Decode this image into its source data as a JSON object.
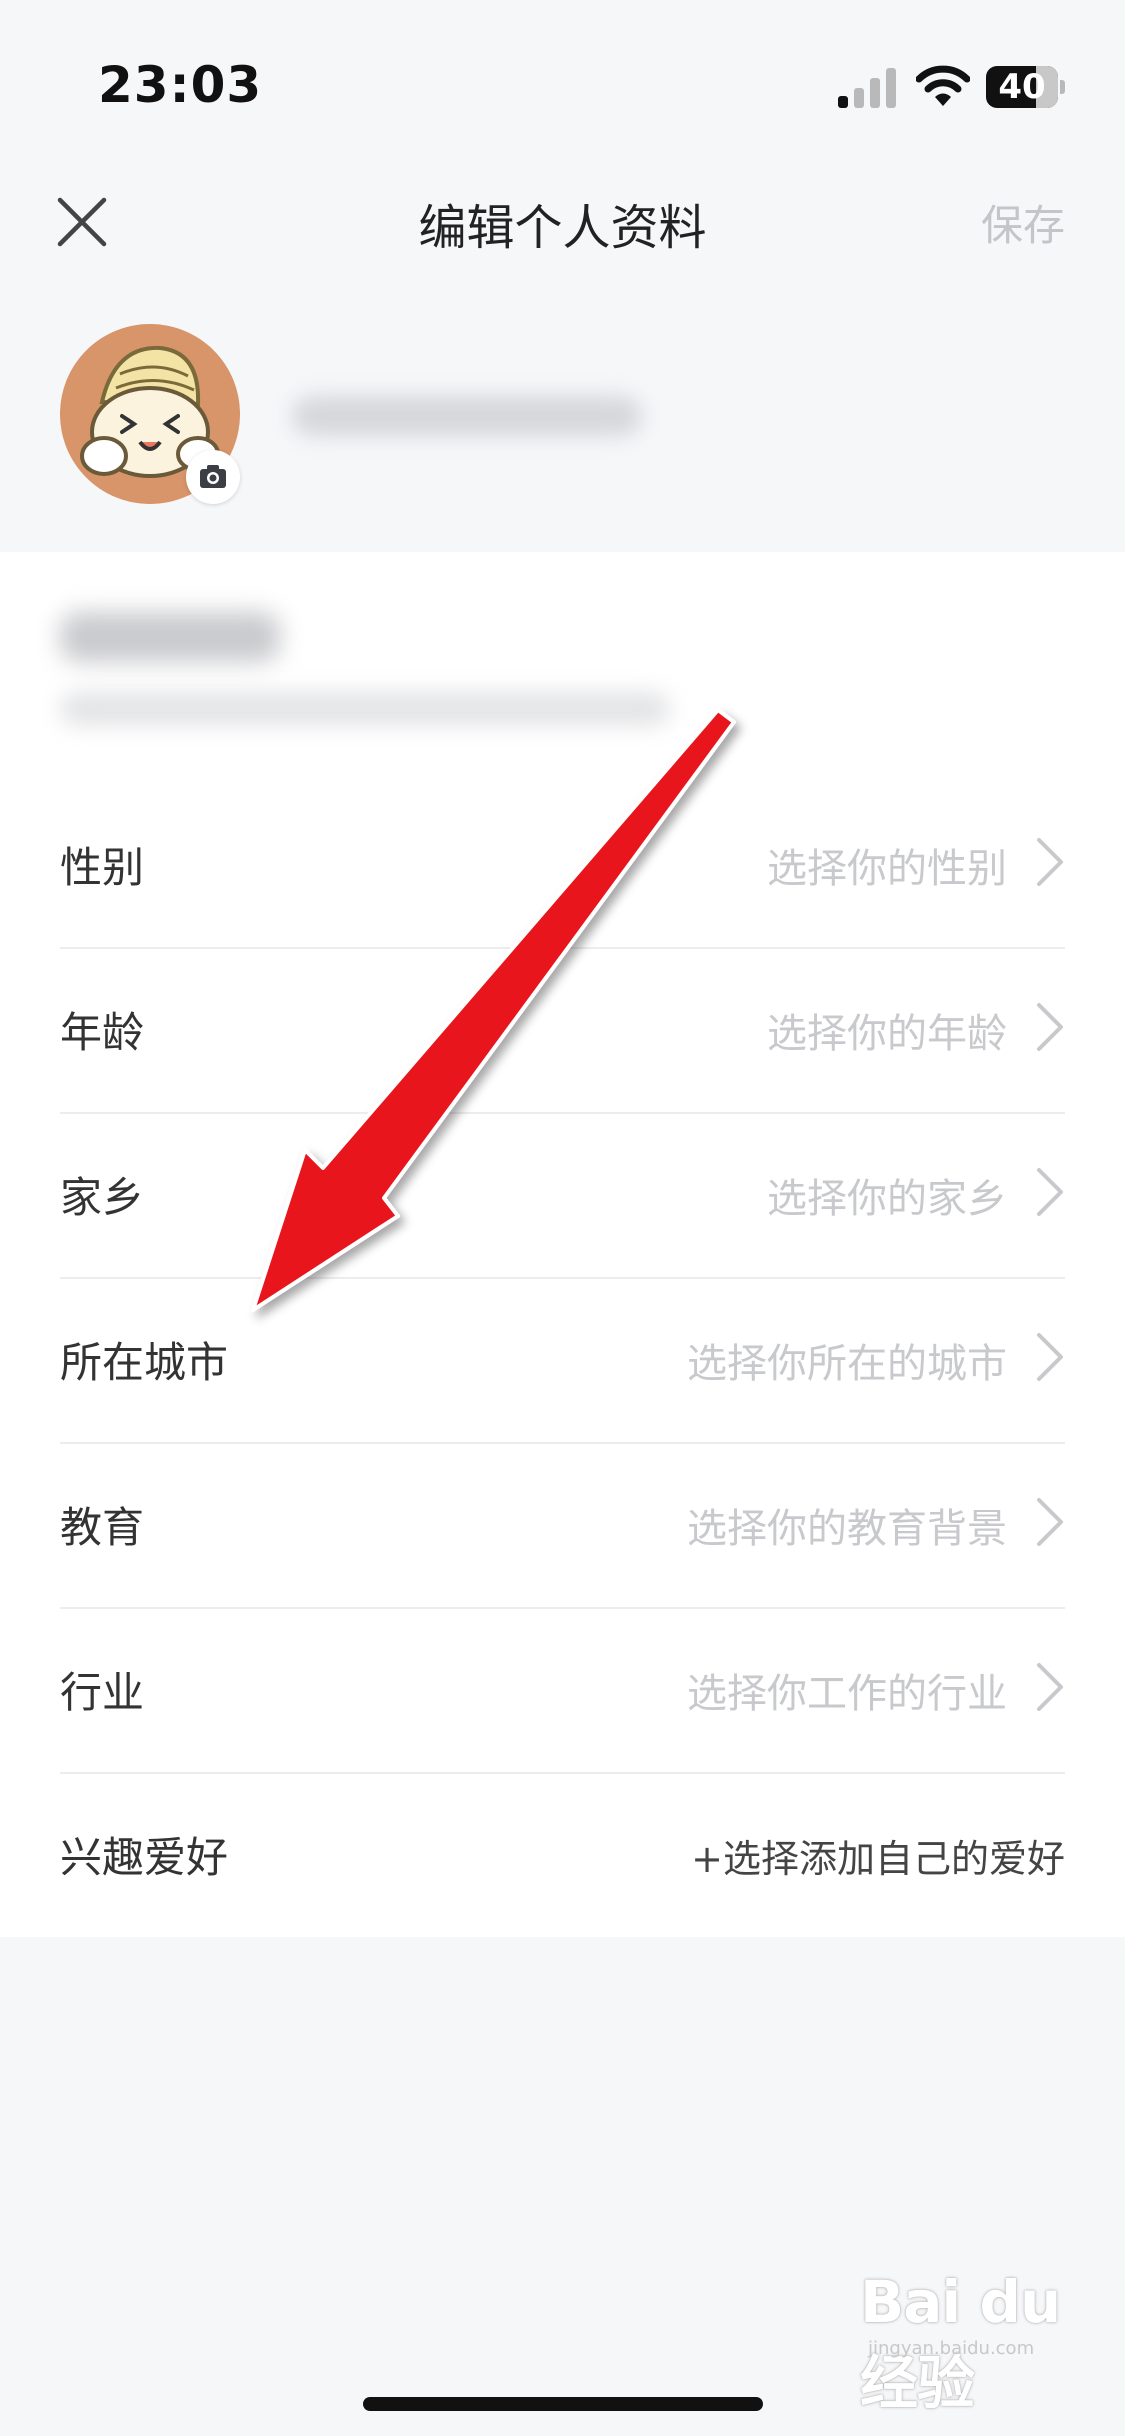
{
  "status_bar": {
    "time": "23:03",
    "battery": "40"
  },
  "header": {
    "title": "编辑个人资料",
    "save_label": "保存"
  },
  "fields": [
    {
      "label": "性别",
      "value": "选择你的性别"
    },
    {
      "label": "年龄",
      "value": "选择你的年龄"
    },
    {
      "label": "家乡",
      "value": "选择你的家乡"
    },
    {
      "label": "所在城市",
      "value": "选择你所在的城市"
    },
    {
      "label": "教育",
      "value": "选择你的教育背景"
    },
    {
      "label": "行业",
      "value": "选择你工作的行业"
    }
  ],
  "interests": {
    "label": "兴趣爱好",
    "value": "+选择添加自己的爱好"
  },
  "watermark": {
    "text": "Bai du 经验",
    "sub": "jingyan.baidu.com"
  },
  "icons": {
    "close": "close-icon",
    "camera": "camera-icon",
    "chevron": "chevron-right-icon",
    "signal": "signal-icon",
    "wifi": "wifi-icon",
    "battery": "battery-icon"
  },
  "colors": {
    "annotation_arrow": "#e8141b",
    "placeholder": "#c8c9cc"
  }
}
